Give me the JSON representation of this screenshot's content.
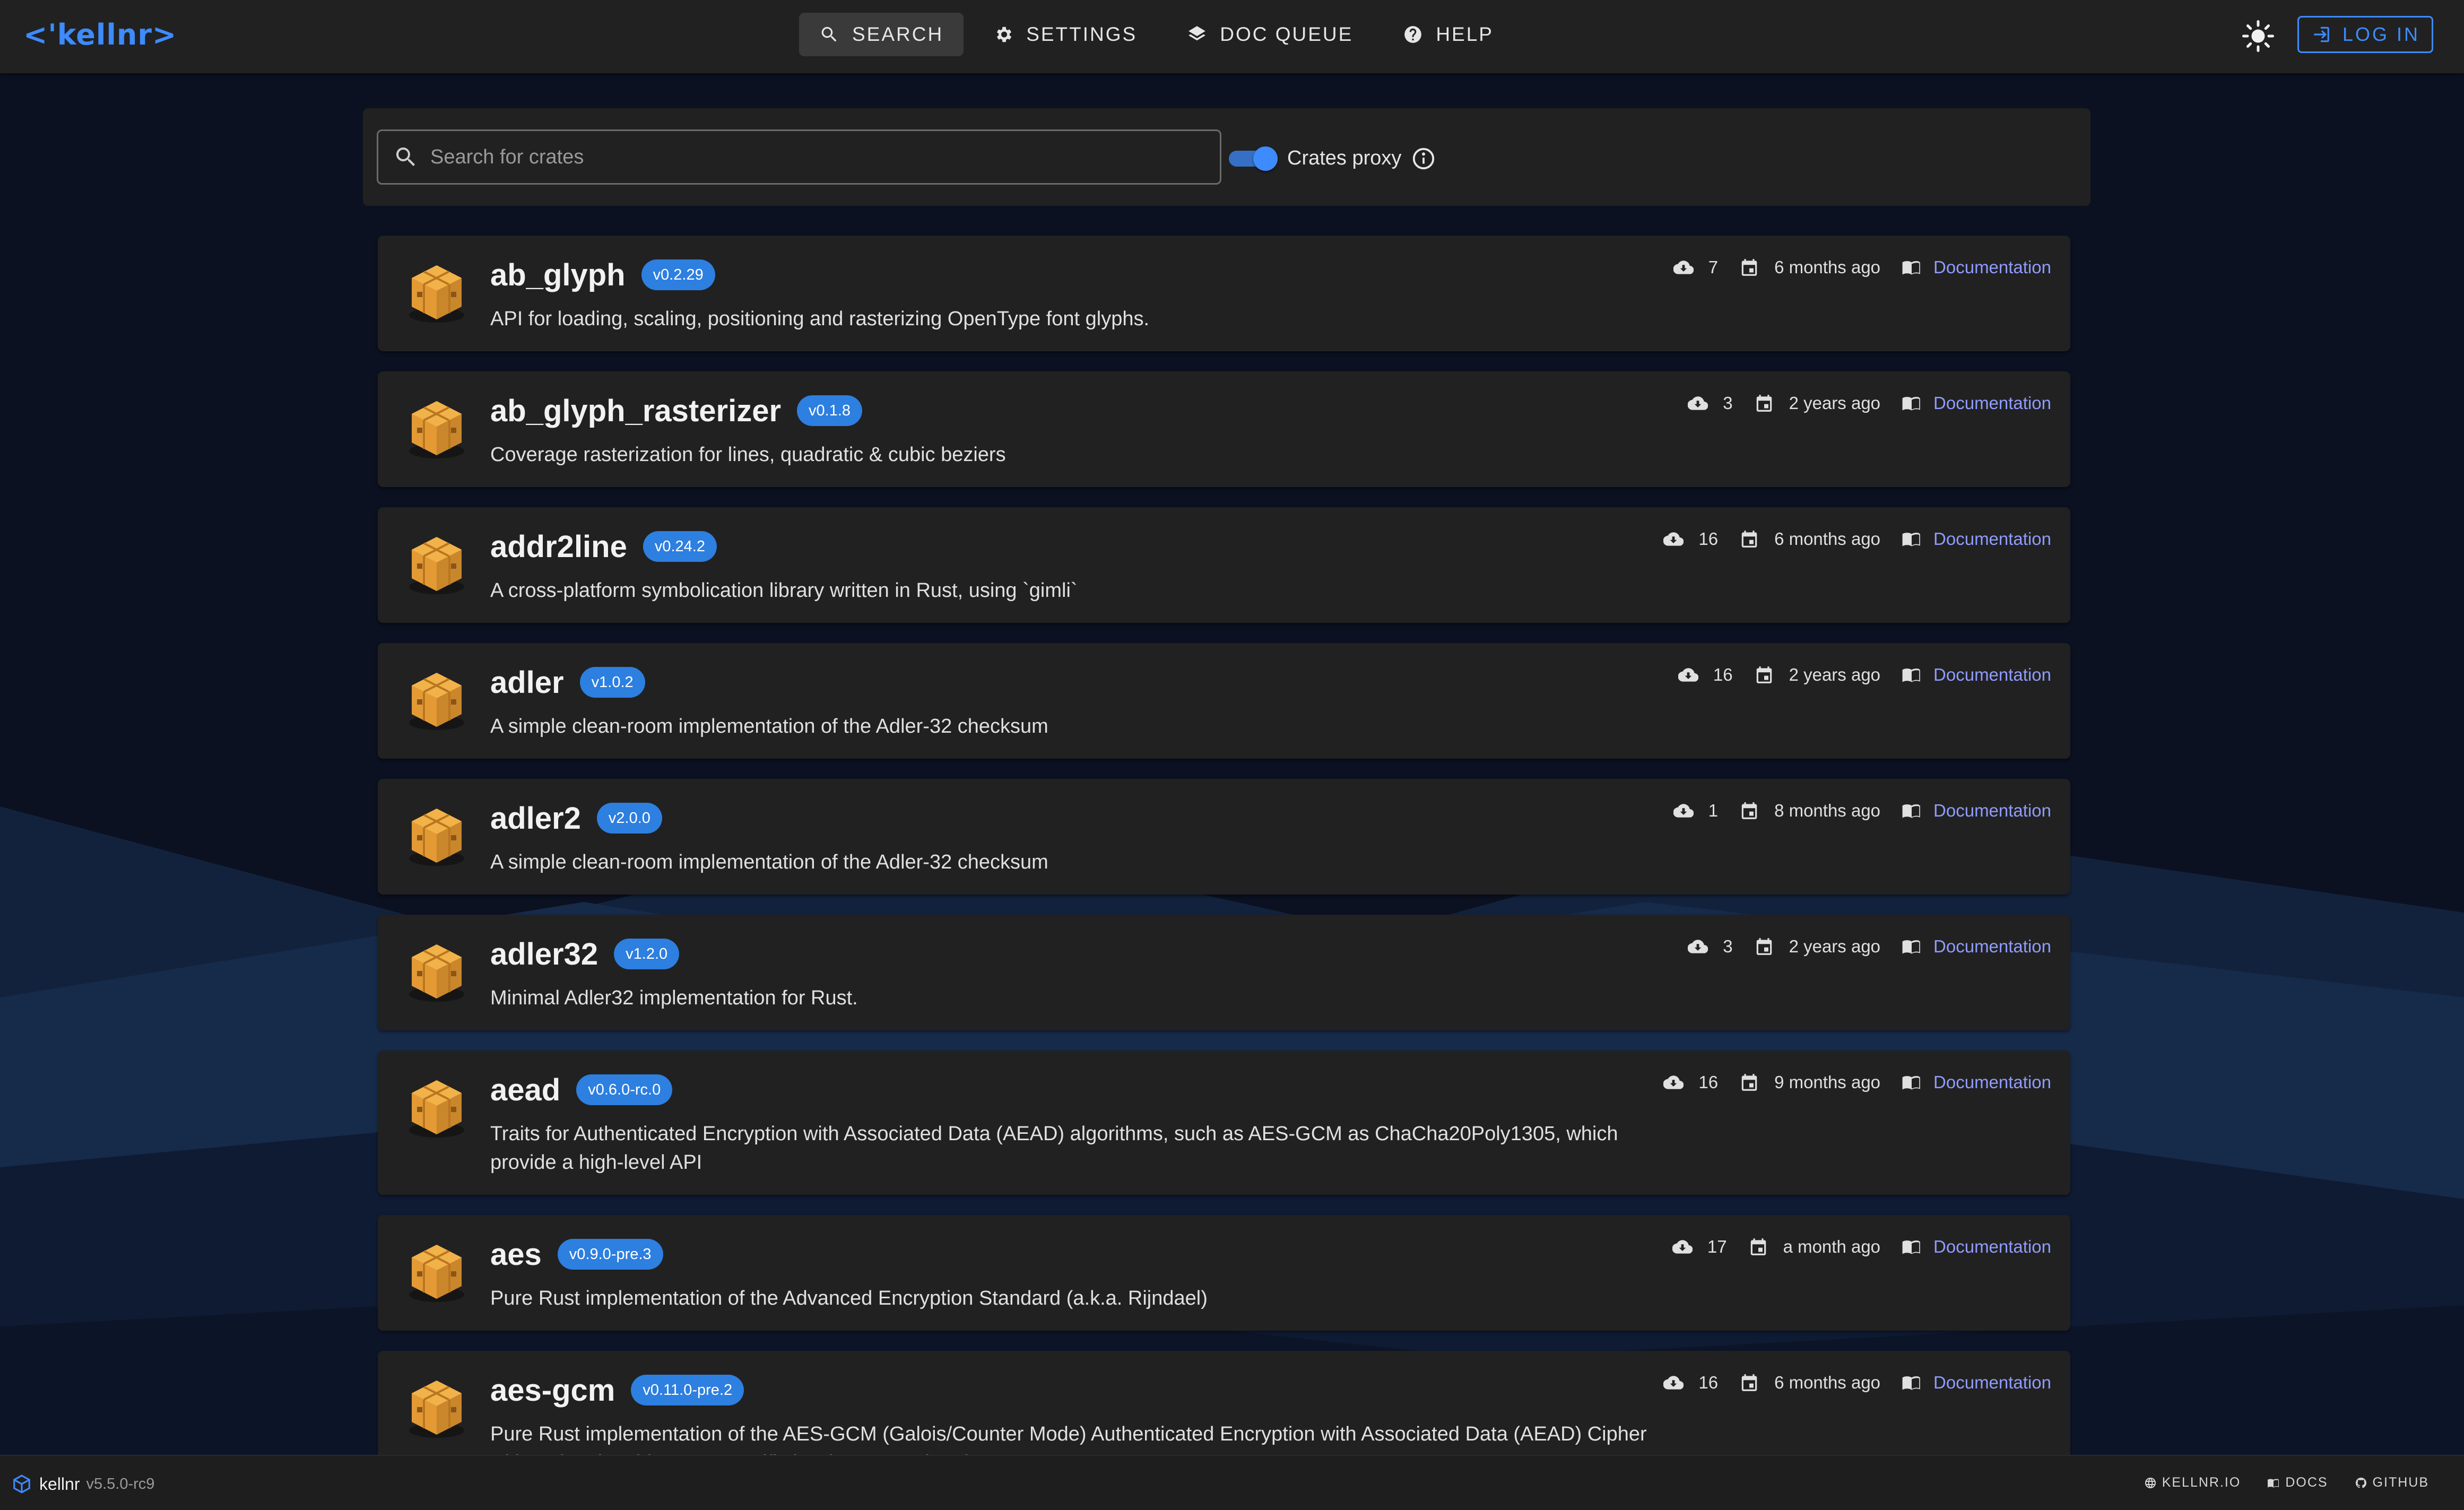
{
  "header": {
    "logo": "<'kellnr>",
    "nav": [
      {
        "label": "SEARCH",
        "icon": "search-icon",
        "active": true
      },
      {
        "label": "SETTINGS",
        "icon": "gear-icon",
        "active": false
      },
      {
        "label": "DOC QUEUE",
        "icon": "layers-icon",
        "active": false
      },
      {
        "label": "HELP",
        "icon": "help-icon",
        "active": false
      }
    ],
    "login_label": "LOG IN"
  },
  "search": {
    "placeholder": "Search for crates",
    "value": "",
    "proxy_label": "Crates proxy",
    "proxy_enabled": true
  },
  "crates": [
    {
      "name": "ab_glyph",
      "version": "v0.2.29",
      "description": "API for loading, scaling, positioning and rasterizing OpenType font glyphs.",
      "downloads": "7",
      "updated": "6 months ago",
      "doc_label": "Documentation"
    },
    {
      "name": "ab_glyph_rasterizer",
      "version": "v0.1.8",
      "description": "Coverage rasterization for lines, quadratic & cubic beziers",
      "downloads": "3",
      "updated": "2 years ago",
      "doc_label": "Documentation"
    },
    {
      "name": "addr2line",
      "version": "v0.24.2",
      "description": "A cross-platform symbolication library written in Rust, using `gimli`",
      "downloads": "16",
      "updated": "6 months ago",
      "doc_label": "Documentation"
    },
    {
      "name": "adler",
      "version": "v1.0.2",
      "description": "A simple clean-room implementation of the Adler-32 checksum",
      "downloads": "16",
      "updated": "2 years ago",
      "doc_label": "Documentation"
    },
    {
      "name": "adler2",
      "version": "v2.0.0",
      "description": "A simple clean-room implementation of the Adler-32 checksum",
      "downloads": "1",
      "updated": "8 months ago",
      "doc_label": "Documentation"
    },
    {
      "name": "adler32",
      "version": "v1.2.0",
      "description": "Minimal Adler32 implementation for Rust.",
      "downloads": "3",
      "updated": "2 years ago",
      "doc_label": "Documentation"
    },
    {
      "name": "aead",
      "version": "v0.6.0-rc.0",
      "description": "Traits for Authenticated Encryption with Associated Data (AEAD) algorithms, such as AES-GCM as ChaCha20Poly1305, which provide a high-level API",
      "downloads": "16",
      "updated": "9 months ago",
      "doc_label": "Documentation"
    },
    {
      "name": "aes",
      "version": "v0.9.0-pre.3",
      "description": "Pure Rust implementation of the Advanced Encryption Standard (a.k.a. Rijndael)",
      "downloads": "17",
      "updated": "a month ago",
      "doc_label": "Documentation"
    },
    {
      "name": "aes-gcm",
      "version": "v0.11.0-pre.2",
      "description": "Pure Rust implementation of the AES-GCM (Galois/Counter Mode) Authenticated Encryption with Associated Data (AEAD) Cipher with optional architecture-specific hardware acceleration",
      "downloads": "16",
      "updated": "6 months ago",
      "doc_label": "Documentation"
    }
  ],
  "footer": {
    "app_name": "kellnr",
    "version": "v5.5.0-rc9",
    "links": [
      "KELLNR.IO",
      "DOCS",
      "GITHUB"
    ]
  },
  "colors": {
    "accent": "#3d8bfd",
    "badge": "#2d7fe0",
    "link": "#8f9cff",
    "surface": "#212121",
    "background": "#0b1120"
  }
}
